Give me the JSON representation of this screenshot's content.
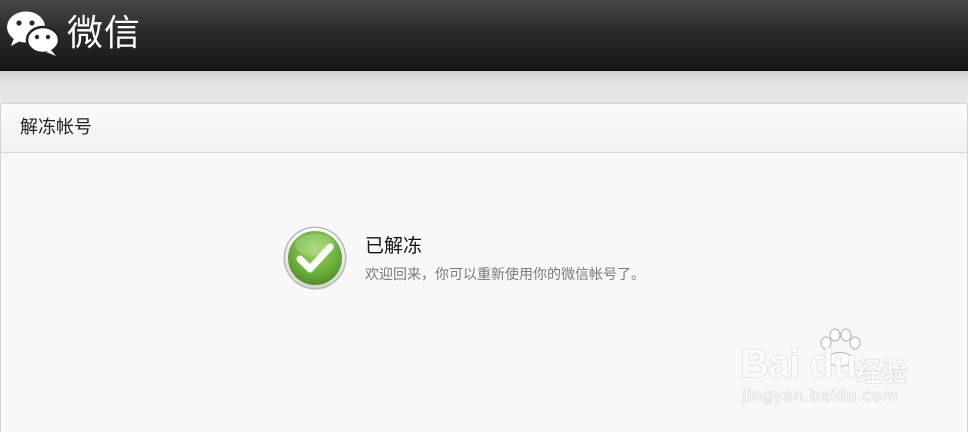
{
  "header": {
    "app_name": "微信",
    "logo_icon": "wechat-logo-icon"
  },
  "panel": {
    "title": "解冻帐号"
  },
  "status": {
    "icon": "success-check-icon",
    "title": "已解冻",
    "description": "欢迎回来，你可以重新使用你的微信帐号了。"
  },
  "watermark": {
    "brand": "Bai du",
    "sub": "经验",
    "url": "jingyan.baidu.com"
  },
  "colors": {
    "header_dark": "#1a1a1a",
    "success_green": "#6bb83a",
    "panel_bg": "#f8f8f8"
  }
}
